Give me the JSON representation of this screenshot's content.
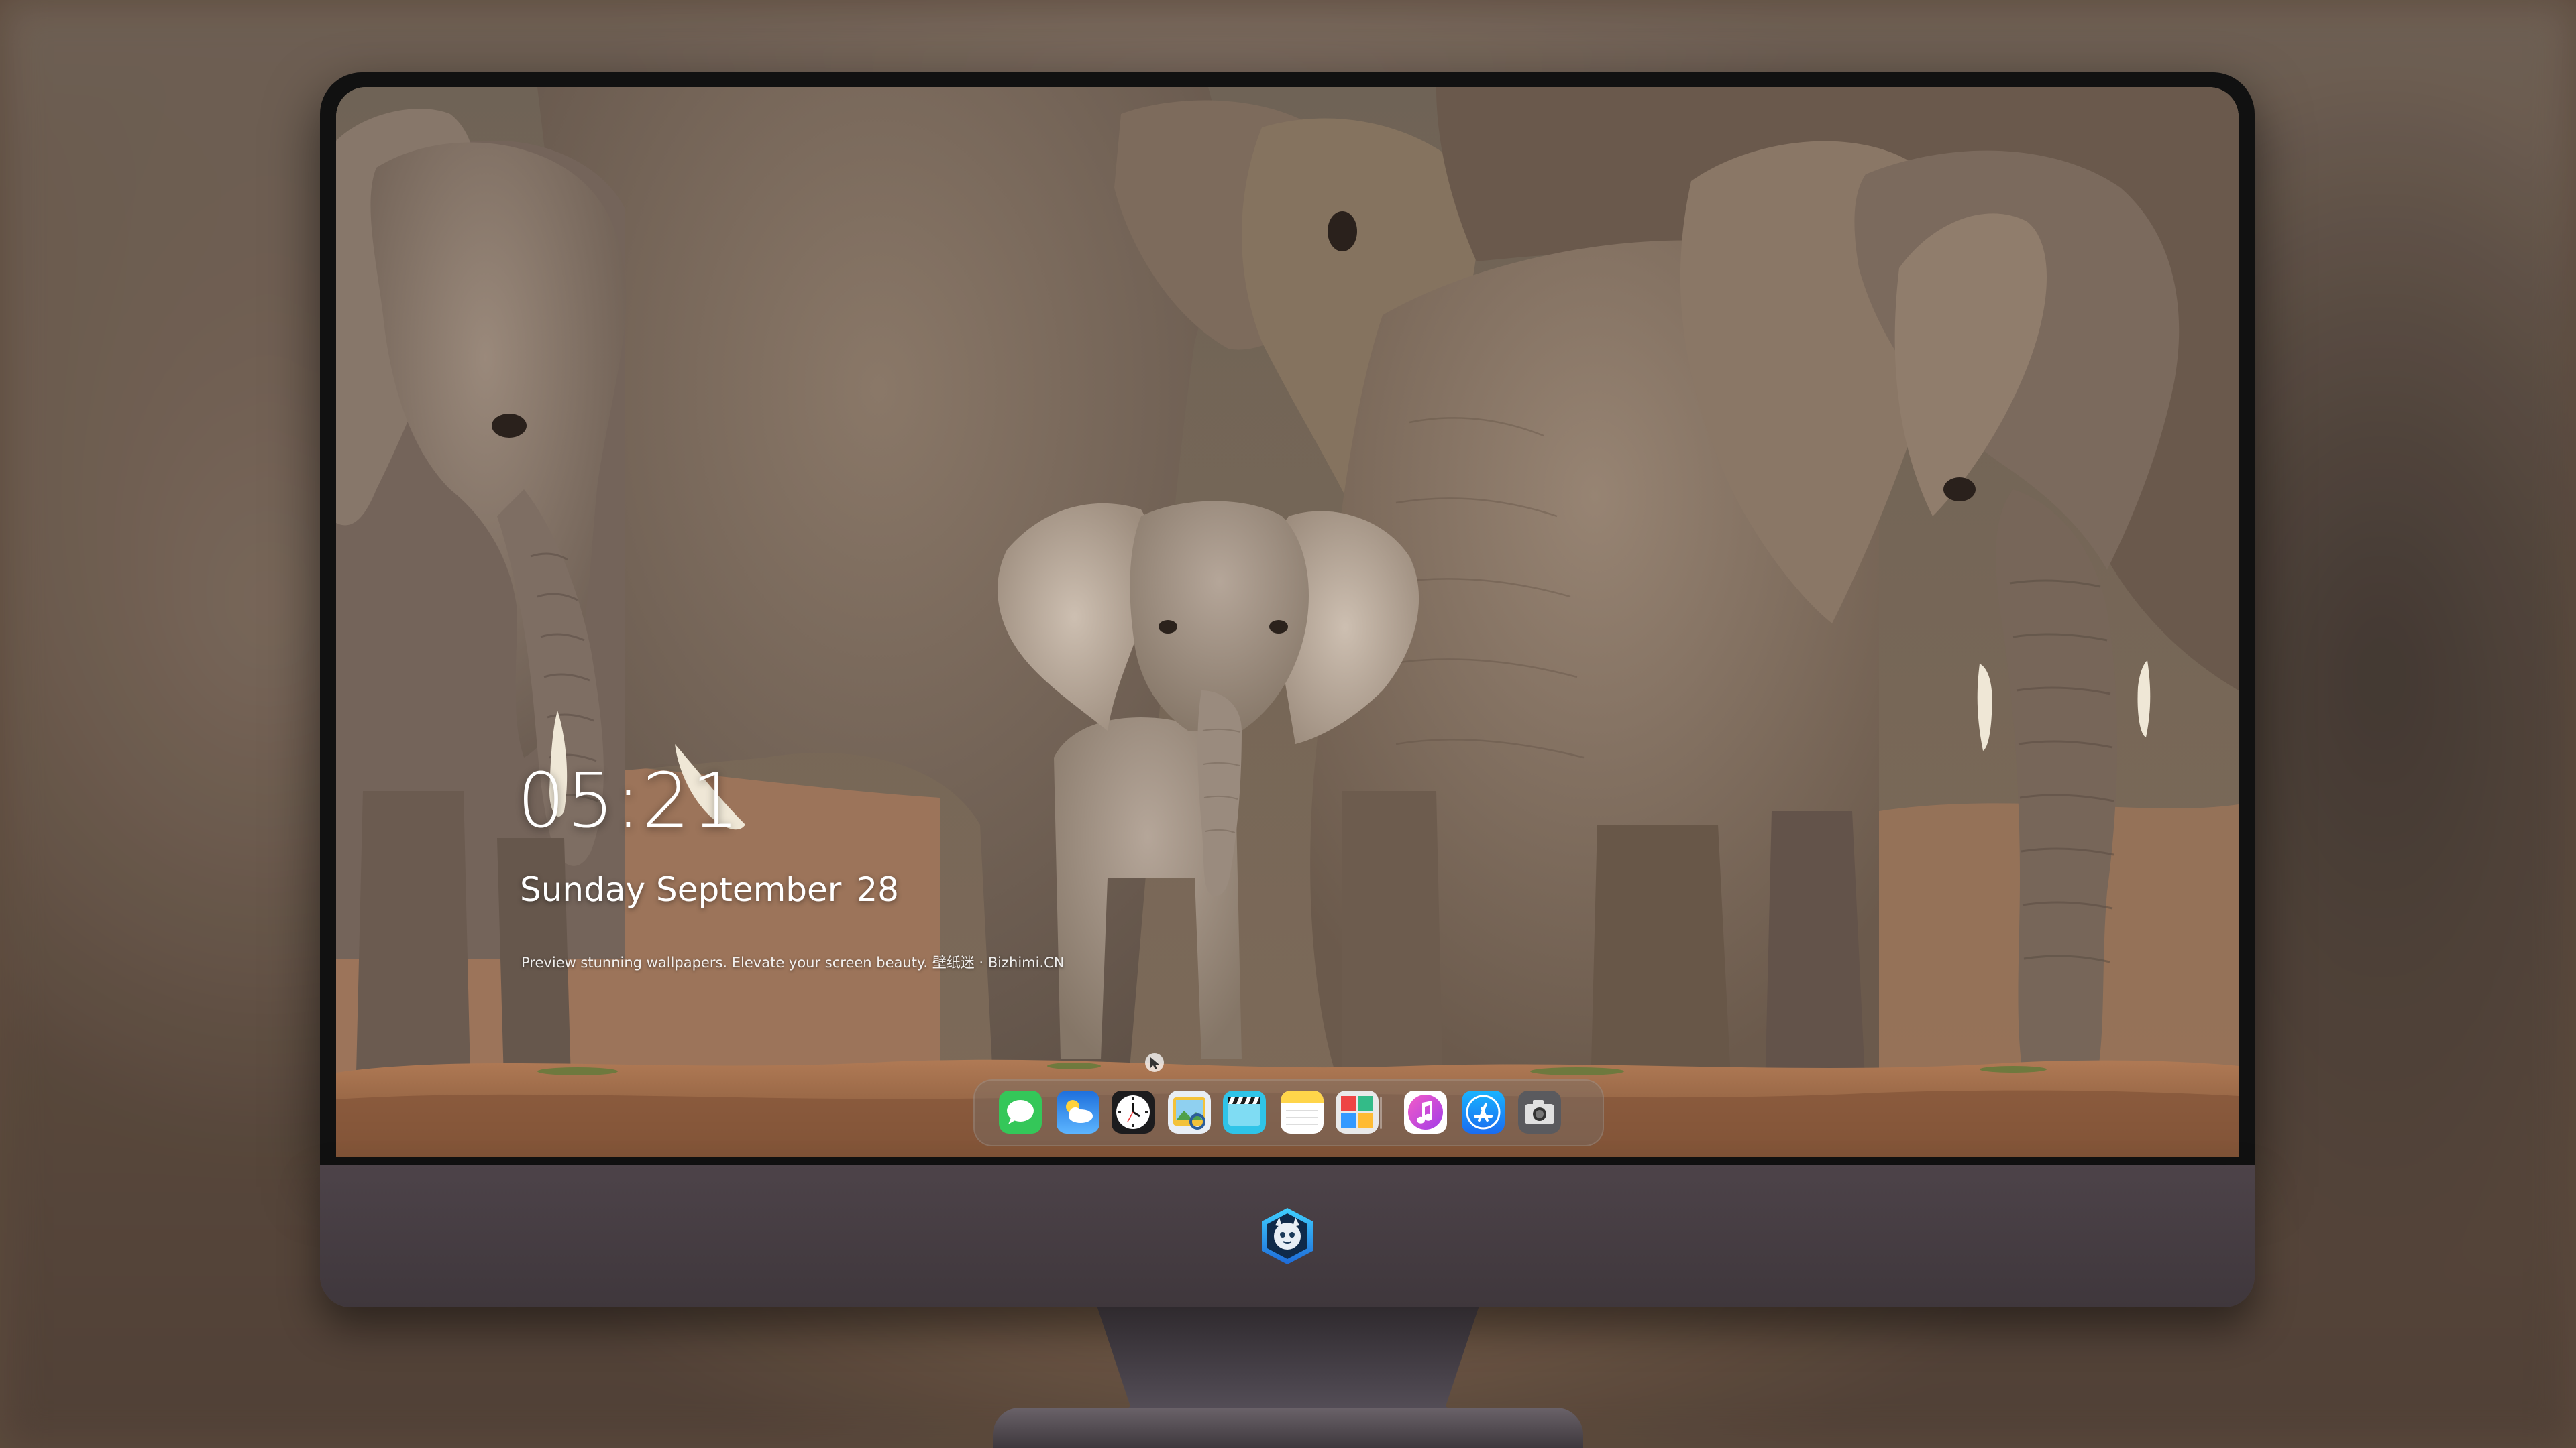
{
  "lock_screen": {
    "time": "05:21",
    "weekday_month": "Sunday September",
    "day": "28",
    "tagline": "Preview stunning wallpapers. Elevate your screen beauty. 壁纸迷 · Bizhimi.CN"
  },
  "wallpaper": {
    "subject": "elephant family with calf",
    "colors": {
      "sky": "#6f6356",
      "elephant_skin": "#8b7a6c",
      "calf_skin": "#a49487",
      "ground": "#a2704d",
      "tusk": "#f1ead8"
    }
  },
  "dock": {
    "apps": [
      {
        "name": "Messages",
        "icon": "messages-icon",
        "color": "#34c759"
      },
      {
        "name": "Weather",
        "icon": "weather-icon",
        "color": "#2f8cf4"
      },
      {
        "name": "Clock",
        "icon": "clock-icon",
        "color": "#1c1c1e"
      },
      {
        "name": "Preview",
        "icon": "preview-icon",
        "color": "#f3c23a"
      },
      {
        "name": "Clips",
        "icon": "clips-icon",
        "color": "#2fc4e8"
      },
      {
        "name": "Notes",
        "icon": "notes-icon",
        "color": "#ffd54a"
      },
      {
        "name": "Photo Booth",
        "icon": "photo-booth-icon",
        "color": "#e9e9e9"
      },
      {
        "name": "iTunes",
        "icon": "itunes-icon",
        "color": "#ea4cc0"
      },
      {
        "name": "App Store",
        "icon": "app-store-icon",
        "color": "#1a8cff"
      },
      {
        "name": "Screenshot",
        "icon": "camera-icon",
        "color": "#5a5a5e"
      }
    ]
  },
  "monitor": {
    "brand_logo": "wallpaper-app-logo"
  }
}
